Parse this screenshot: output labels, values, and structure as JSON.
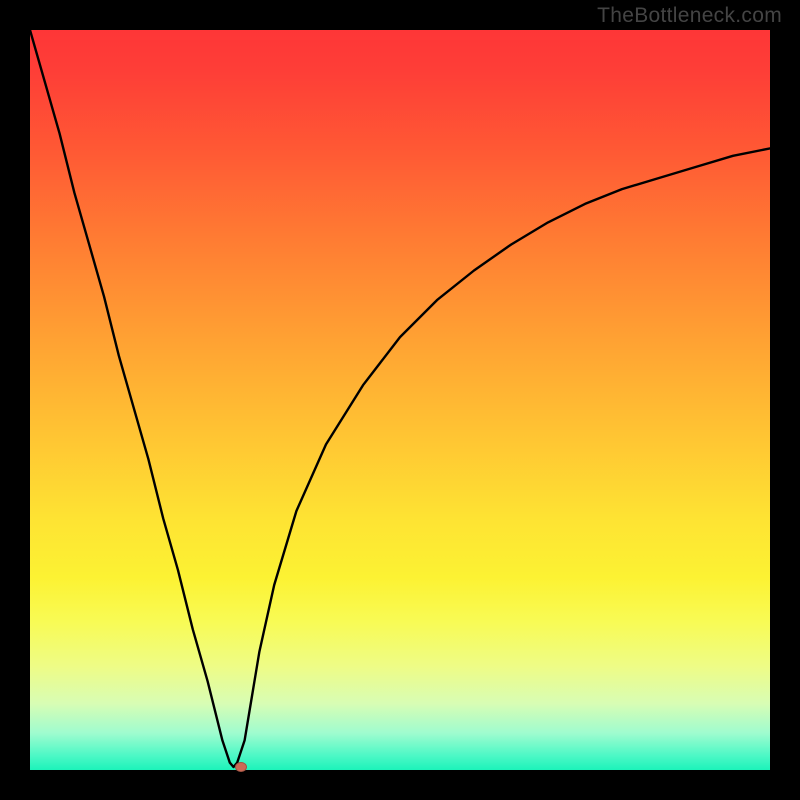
{
  "watermark": "TheBottleneck.com",
  "chart_data": {
    "type": "line",
    "title": "",
    "xlabel": "",
    "ylabel": "",
    "xlim": [
      0,
      100
    ],
    "ylim": [
      0,
      100
    ],
    "x": [
      0,
      2,
      4,
      6,
      8,
      10,
      12,
      14,
      16,
      18,
      20,
      22,
      24,
      26,
      27,
      27.5,
      28,
      29,
      30,
      31,
      33,
      36,
      40,
      45,
      50,
      55,
      60,
      65,
      70,
      75,
      80,
      85,
      90,
      95,
      100
    ],
    "values": [
      100,
      93,
      86,
      78,
      71,
      64,
      56,
      49,
      42,
      34,
      27,
      19,
      12,
      4,
      1,
      0.4,
      1,
      4,
      10,
      16,
      25,
      35,
      44,
      52,
      58.5,
      63.5,
      67.5,
      71,
      74,
      76.5,
      78.5,
      80,
      81.5,
      83,
      84
    ],
    "marker": {
      "x": 28.5,
      "y": 0.4
    },
    "grid": false,
    "legend": false
  },
  "colors": {
    "curve": "#000000",
    "marker": "#cb6a56",
    "background_top": "#fe3637",
    "background_bottom": "#1cf3ba",
    "frame": "#000000"
  }
}
